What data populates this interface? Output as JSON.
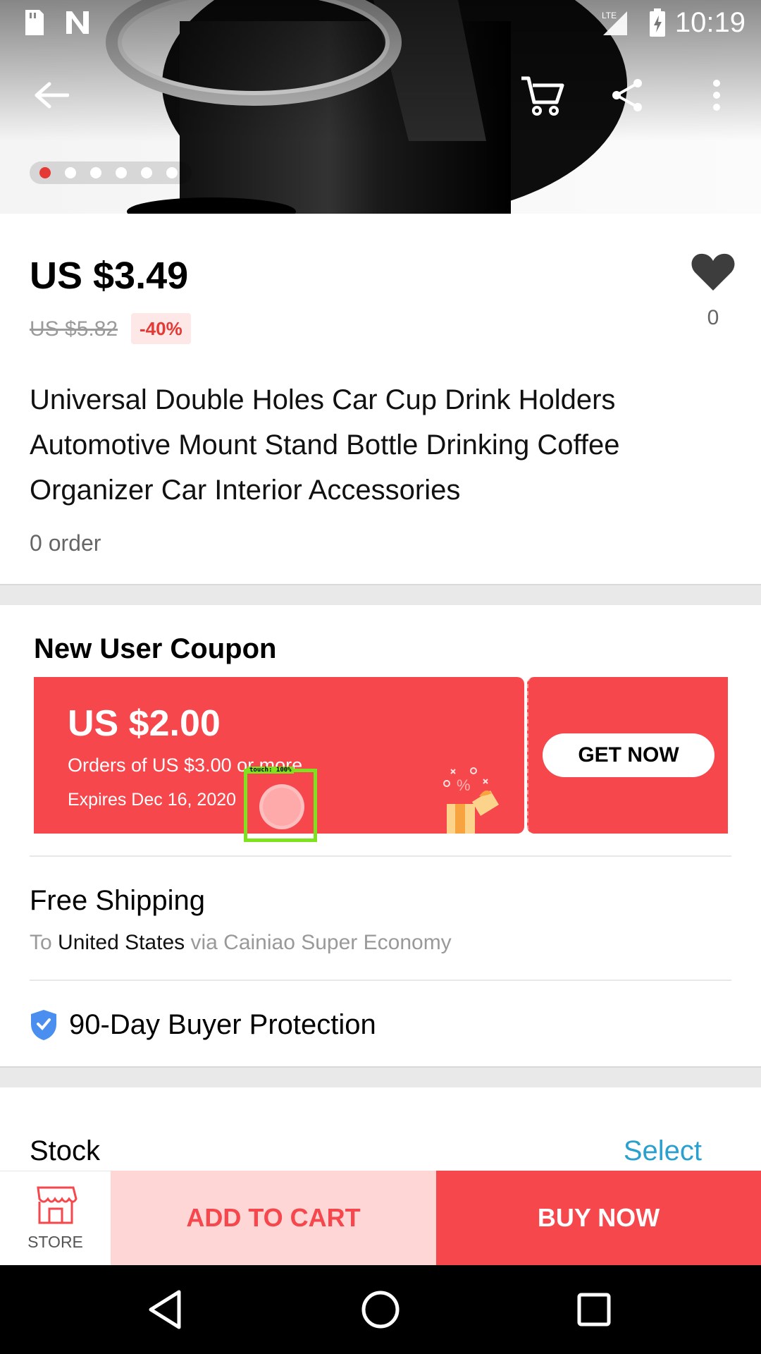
{
  "status_bar": {
    "time": "10:19",
    "network": "LTE"
  },
  "gallery": {
    "dot_count": 6,
    "active_index": 0
  },
  "product": {
    "price": "US $3.49",
    "original_price": "US $5.82",
    "discount": "-40%",
    "wishlist_count": "0",
    "title": "Universal Double Holes Car Cup Drink Holders Automotive Mount Stand Bottle Drinking Coffee Organizer Car Interior Accessories",
    "orders": "0 order"
  },
  "coupon": {
    "heading": "New User Coupon",
    "amount": "US $2.00",
    "condition": "Orders of US $3.00 or more",
    "expires": "Expires Dec 16, 2020",
    "button": "GET NOW"
  },
  "touch_overlay": {
    "label": "touch: 100%"
  },
  "shipping": {
    "heading": "Free Shipping",
    "prefix": "To",
    "country": "United States",
    "suffix": "via Cainiao Super Economy"
  },
  "protection": {
    "label": "90-Day Buyer Protection"
  },
  "stock": {
    "label": "Stock",
    "action": "Select"
  },
  "bottom_bar": {
    "store": "STORE",
    "add_to_cart": "ADD TO CART",
    "buy_now": "BUY NOW"
  },
  "colors": {
    "accent": "#f5474c",
    "accent_light": "#fed6d6",
    "link": "#2b9fcd",
    "touch_box": "#7ee21f"
  }
}
